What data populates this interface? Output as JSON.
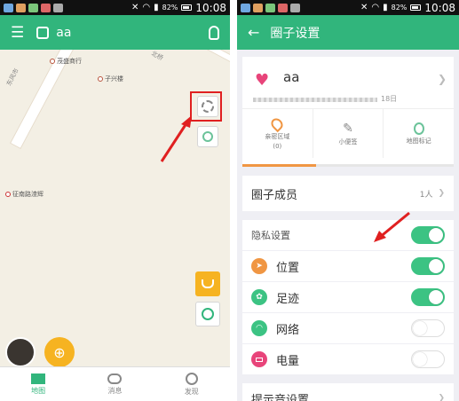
{
  "status": {
    "battery": "82%",
    "time": "10:08"
  },
  "left": {
    "title": "aa",
    "map": {
      "poi": [
        "茂盛商行",
        "子兴楼",
        "征南路渣辉"
      ],
      "road": "东风市",
      "road2": "北桥"
    },
    "nav": [
      "地图",
      "消息",
      "发现"
    ]
  },
  "right": {
    "title": "圈子设置",
    "profile": {
      "name": "aa",
      "date_suffix": "18日"
    },
    "quick": [
      {
        "label": "亲密区域",
        "sub": "(0)"
      },
      {
        "label": "小便签",
        "sub": ""
      },
      {
        "label": "地图标记",
        "sub": ""
      }
    ],
    "members": {
      "label": "圈子成员",
      "count": "1人"
    },
    "rows": [
      {
        "label": "隐私设置"
      },
      {
        "label": "位置"
      },
      {
        "label": "足迹"
      },
      {
        "label": "网络"
      },
      {
        "label": "电量"
      }
    ],
    "tone": {
      "label": "提示音设置"
    }
  },
  "colors": {
    "brand": "#31b57c",
    "accent": "#f6b321",
    "highlight": "#e02020"
  }
}
